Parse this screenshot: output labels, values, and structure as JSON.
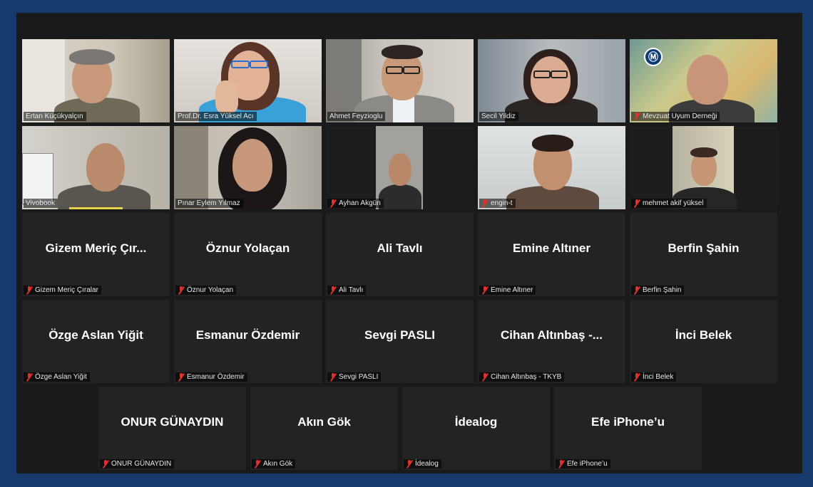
{
  "meeting": {
    "video_tiles": [
      {
        "name": "Ertan Küçükyalçın",
        "muted": false
      },
      {
        "name": "Prof.Dr. Esra Yüksel Acı",
        "muted": false
      },
      {
        "name": "Ahmet Feyzioglu",
        "muted": false
      },
      {
        "name": "Secil Yildiz",
        "muted": false,
        "active_speaker": true
      },
      {
        "name": "Mevzuat Uyum Derneği",
        "muted": true
      },
      {
        "name": "Vivobook",
        "muted": false
      },
      {
        "name": "Pınar Eylem Yılmaz",
        "muted": false
      },
      {
        "name": "Ayhan Akgün",
        "muted": true
      },
      {
        "name": "engin-t",
        "muted": true
      },
      {
        "name": "mehmet akif yüksel",
        "muted": true
      }
    ],
    "name_tiles": [
      {
        "display": "Gizem  Meriç  Çır...",
        "label": "Gizem Meriç Çıralar"
      },
      {
        "display": "Öznur Yolaçan",
        "label": "Öznur Yolaçan"
      },
      {
        "display": "Ali Tavlı",
        "label": "Ali Tavlı"
      },
      {
        "display": "Emine Altıner",
        "label": "Emine Altıner"
      },
      {
        "display": "Berfin Şahin",
        "label": "Berfin Şahin"
      },
      {
        "display": "Özge Aslan Yiğit",
        "label": "Özge Aslan Yiğit"
      },
      {
        "display": "Esmanur Özdemir",
        "label": "Esmanur Özdemir"
      },
      {
        "display": "Sevgi PASLI",
        "label": "Sevgi PASLI"
      },
      {
        "display": "Cihan  Altınbaş  -...",
        "label": "Cihan Altınbaş - TKYB"
      },
      {
        "display": "İnci Belek",
        "label": "İnci Belek"
      },
      {
        "display": "ONUR GÜNAYDIN",
        "label": "ONUR GÜNAYDIN"
      },
      {
        "display": "Akın Gök",
        "label": "Akın Gök"
      },
      {
        "display": "İdealog",
        "label": "İdealog"
      },
      {
        "display": "Efe iPhone’u",
        "label": "Efe iPhone’u"
      }
    ]
  },
  "colors": {
    "frame": "#153a6b",
    "stage": "#1a1a1a",
    "tile": "#232323",
    "active_border": "#c8d64a",
    "mute_icon": "#e0322c"
  }
}
